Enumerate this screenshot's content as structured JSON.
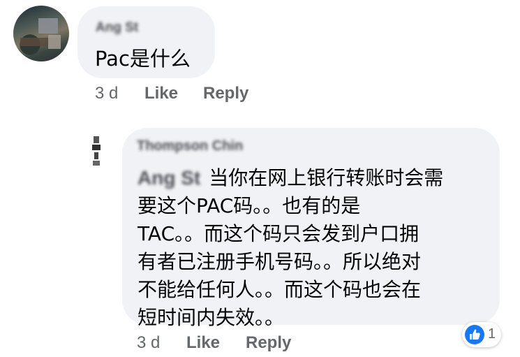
{
  "comment_1": {
    "author": "Ang St",
    "text": "Pac是什么",
    "time": "3 d",
    "like_label": "Like",
    "reply_label": "Reply"
  },
  "comment_2": {
    "author": "Thompson Chin",
    "mention": "Ang St",
    "lines": [
      "当你在网上银行转账时会需",
      "要这个PAC码。。也有的是",
      "TAC。。而这个码只会发到户口拥",
      "有者已注册手机号码。。所以绝对",
      "不能给任何人。。而这个码也会在",
      "短时间内失效。。"
    ],
    "time": "3 d",
    "like_label": "Like",
    "reply_label": "Reply",
    "reactions": {
      "icon": "like-icon",
      "count": "1",
      "color": "#1877f2"
    }
  }
}
